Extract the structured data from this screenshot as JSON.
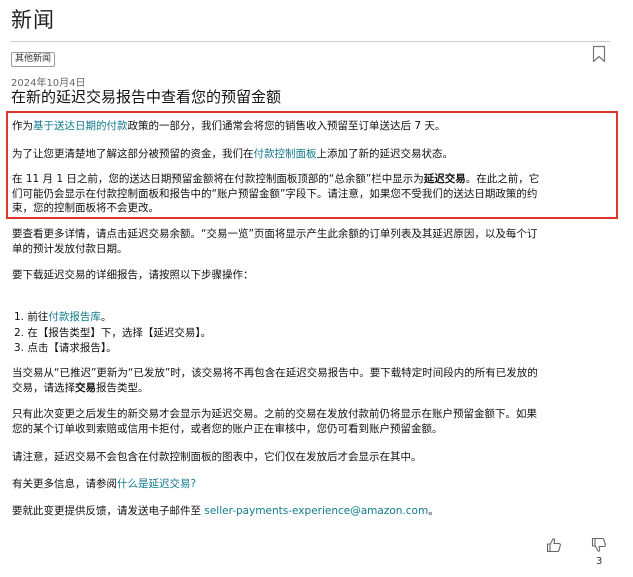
{
  "header": {
    "title": "新闻"
  },
  "tag": "其他新闻",
  "date": "2024年10月4日",
  "article_title": "在新的延迟交易报告中查看您的预留金额",
  "highlight": {
    "p1": {
      "a": "作为",
      "link": "基于送达日期的付款",
      "b": "政策的一部分，我们通常会将您的销售收入预留至订单送达后 7 天。"
    },
    "p2": {
      "a": "为了让您更清楚地了解这部分被预留的资金，我们在",
      "link": "付款控制面板",
      "b": "上添加了新的延迟交易状态。"
    },
    "p3": {
      "line1a": "在 11 月 1 日之前，您的送达日期预留金额将在付款控制面板顶部的“总余额”栏中显示为",
      "line1bold": "延迟交易",
      "line1b": "。在此之前，它",
      "line2": "们可能仍会显示在付款控制面板和报告中的“账户预留金额”字段下。请注意，如果您不受我们的送达日期政策的约",
      "line3": "束，您的控制面板将不会更改。"
    }
  },
  "body": {
    "p4_line1": "要查看更多详情，请点击延迟交易余额。“交易一览”页面将显示产生此余额的订单列表及其延迟原因，以及每个订",
    "p4_line2": "单的预计发放付款日期。",
    "p5": "要下载延迟交易的详细报告，请按照以下步骤操作：",
    "steps": {
      "s1a": "1. 前往",
      "s1link": "付款报告库",
      "s1b": "。",
      "s2": "2. 在【报告类型】下，选择【延迟交易】。",
      "s3": "3. 点击【请求报告】。"
    },
    "p6_line1": "当交易从“已推迟”更新为“已发放”时，该交易将不再包含在延迟交易报告中。要下载特定时间段内的所有已发放的",
    "p6_line2a": "交易，请选择",
    "p6_line2bold": "交易",
    "p6_line2b": "报告类型。",
    "p7_line1": "只有此次变更之后发生的新交易才会显示为延迟交易。之前的交易在发放付款前仍将显示在账户预留金额下。如果",
    "p7_line2": "您的某个订单收到索赔或信用卡拒付，或者您的账户正在审核中，您仍可看到账户预留金额。",
    "p8": "请注意，延迟交易不会包含在付款控制面板的图表中，它们仅在发放后才会显示在其中。",
    "p9a": "有关更多信息，请参阅",
    "p9link": "什么是延迟交易?",
    "p10a": "要就此变更提供反馈，请发送电子邮件至 ",
    "p10link": "seller-payments-experience@amazon.com",
    "p10b": "。"
  },
  "footer": {
    "dislike_count": "3"
  }
}
